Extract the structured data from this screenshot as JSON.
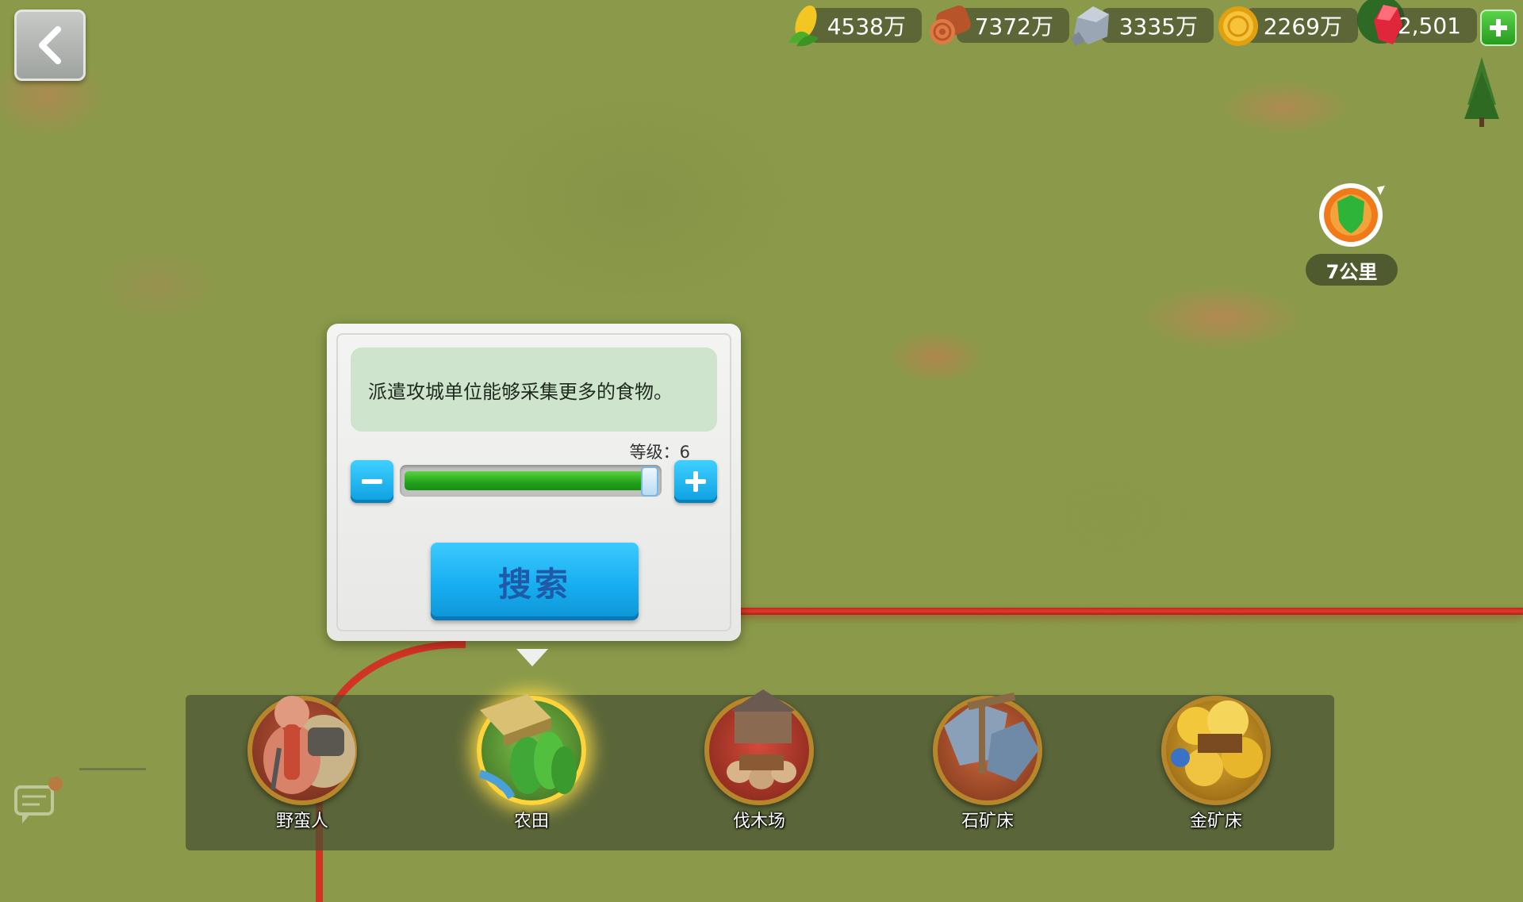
{
  "top_bar": {
    "back_icon": "chevron-left-icon",
    "resources": [
      {
        "name": "food",
        "icon": "corn-icon",
        "value": "4538万"
      },
      {
        "name": "wood",
        "icon": "log-icon",
        "value": "7372万"
      },
      {
        "name": "stone",
        "icon": "stone-icon",
        "value": "3335万"
      },
      {
        "name": "gold",
        "icon": "gold-coin-icon",
        "value": "2269万"
      },
      {
        "name": "gems",
        "icon": "red-gem-icon",
        "value": "2,501"
      }
    ],
    "add_icon": "plus-icon"
  },
  "map_marker": {
    "icon": "green-shield-icon",
    "distance": "7公里"
  },
  "search_panel": {
    "description": "派遣攻城单位能够采集更多的食物。",
    "level_label": "等级：6",
    "level": 6,
    "level_fill_fraction": 1.0,
    "minus_icon": "minus-icon",
    "plus_icon": "plus-icon",
    "search_button": "搜索"
  },
  "categories": [
    {
      "label": "野蛮人",
      "icon": "barbarian-icon",
      "selected": false
    },
    {
      "label": "农田",
      "icon": "farm-icon",
      "selected": true
    },
    {
      "label": "伐木场",
      "icon": "lumber-mill-icon",
      "selected": false
    },
    {
      "label": "石矿床",
      "icon": "stone-deposit-icon",
      "selected": false
    },
    {
      "label": "金矿床",
      "icon": "gold-deposit-icon",
      "selected": false
    }
  ],
  "colors": {
    "map_grass": "#8a9a4a",
    "territory_border": "#d03424",
    "button_blue": "#17aef0",
    "slider_green": "#23a11a",
    "selected_glow": "#ffd43a"
  }
}
